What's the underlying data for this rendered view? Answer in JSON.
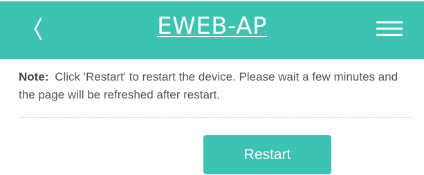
{
  "header": {
    "title": "EWEB-AP",
    "back_icon": "chevron-left-icon",
    "menu_icon": "hamburger-menu-icon",
    "background_color": "#3cc3b1"
  },
  "note": {
    "label": "Note:",
    "text": "Click 'Restart' to restart the device. Please wait a few minutes and the page will be refreshed after restart."
  },
  "actions": {
    "restart_label": "Restart",
    "button_color": "#3cc3b1"
  }
}
